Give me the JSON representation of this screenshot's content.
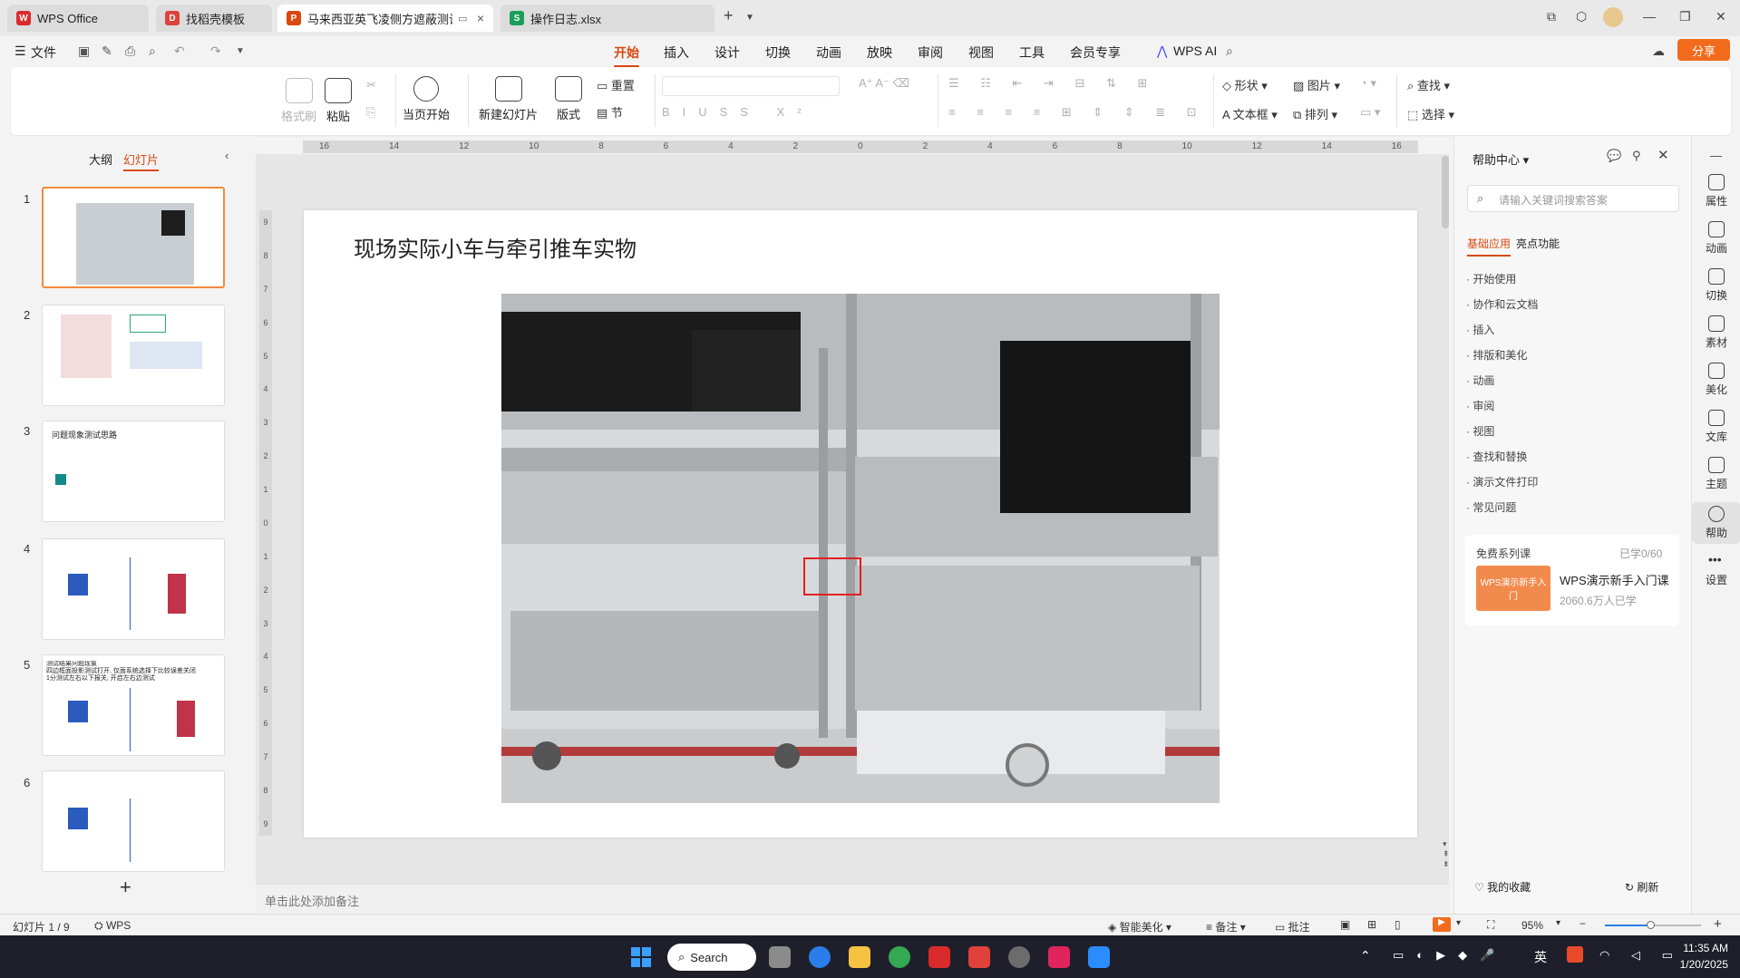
{
  "tabs": [
    {
      "label": "WPS Office",
      "icon": "wps-logo-icon",
      "color": "#d92b2b"
    },
    {
      "label": "找稻壳模板",
      "icon": "docer-icon",
      "color": "#e0413b"
    },
    {
      "label": "马来西亚英飞凌侧方遮蔽测试",
      "icon": "presentation-icon",
      "color": "#d9480f"
    },
    {
      "label": "操作日志.xlsx",
      "icon": "spreadsheet-icon",
      "color": "#1a9e5a"
    }
  ],
  "menu": {
    "file": "文件",
    "items": [
      "开始",
      "插入",
      "设计",
      "切换",
      "动画",
      "放映",
      "审阅",
      "视图",
      "工具",
      "会员专享"
    ],
    "active": "开始",
    "wps_ai": "WPS AI",
    "share": "分享"
  },
  "ribbon": {
    "format_painter": "格式刷",
    "paste": "粘贴",
    "play_from_current": "当页开始",
    "new_slide": "新建幻灯片",
    "layout": "版式",
    "reset": "重置",
    "section": "节",
    "shapes": "形状",
    "image": "图片",
    "textbox": "文本框",
    "arrange": "排列",
    "find": "查找",
    "select": "选择"
  },
  "ruler": {
    "h_ticks": [
      "16",
      "14",
      "12",
      "10",
      "8",
      "6",
      "4",
      "2",
      "0",
      "2",
      "4",
      "6",
      "8",
      "10",
      "12",
      "14",
      "16"
    ],
    "v_ticks": [
      "9",
      "8",
      "7",
      "6",
      "5",
      "4",
      "3",
      "2",
      "1",
      "0",
      "1",
      "2",
      "3",
      "4",
      "5",
      "6",
      "7",
      "8",
      "9"
    ]
  },
  "left_panel": {
    "outline_tab": "大纲",
    "slides_tab": "幻灯片",
    "slide_numbers": [
      "1",
      "2",
      "3",
      "4",
      "5",
      "6"
    ],
    "thumb3_title": "问题现象测试思路",
    "thumb5_lines": [
      "测试结果问题现象",
      "四边框面投影测试打开, 仅面系统选择下比较误差关闭",
      "1分测试左右以下报关, 开启左右边测试"
    ]
  },
  "slide": {
    "title": "现场实际小车与牵引推车实物"
  },
  "notes_placeholder": "单击此处添加备注",
  "help_panel": {
    "title": "帮助中心",
    "search_placeholder": "请输入关键词搜索答案",
    "tabs": [
      "基础应用",
      "亮点功能"
    ],
    "items": [
      "开始使用",
      "协作和云文档",
      "插入",
      "排版和美化",
      "动画",
      "审阅",
      "视图",
      "查找和替换",
      "演示文件打印",
      "常见问题"
    ],
    "course_header": "免费系列课",
    "course_progress": "已学0/60",
    "course_thumb_text": "WPS演示新手入门",
    "course_title": "WPS演示新手入门课",
    "course_learners": "2060.6万人已学",
    "favorites": "我的收藏",
    "refresh": "刷新"
  },
  "right_bar": [
    "属性",
    "动画",
    "切换",
    "素材",
    "美化",
    "文库",
    "主题",
    "帮助",
    "设置"
  ],
  "status_bar": {
    "slide_counter": "幻灯片 1 / 9",
    "app": "WPS",
    "smart_beautify": "智能美化",
    "notes": "备注",
    "comments": "批注",
    "zoom": "95%"
  },
  "taskbar": {
    "search": "Search",
    "ime": "英",
    "time": "11:35 AM",
    "date": "1/20/2025"
  }
}
